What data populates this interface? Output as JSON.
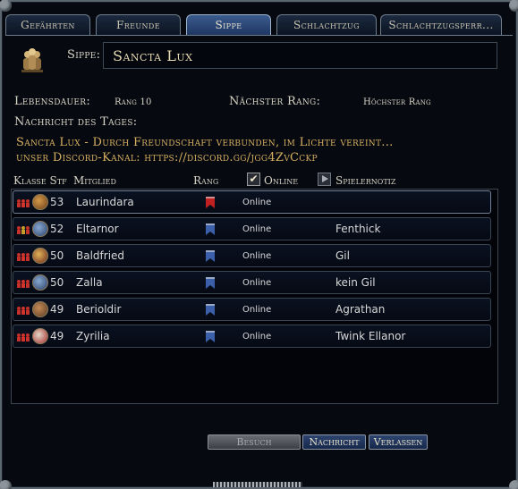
{
  "tabs": [
    "Gefährten",
    "Freunde",
    "Sippe",
    "Schlachtzug",
    "Schlachtzugsperr..."
  ],
  "active_tab": "Sippe",
  "kinship": {
    "name_label": "Sippe:",
    "name": "Sancta Lux",
    "lifetime_label": "Lebensdauer:",
    "lifetime_value": "Rang 10",
    "next_rank_label": "Nächster Rang:",
    "next_rank_value": "Höchster Rang",
    "motd_label": "Nachricht des Tages:",
    "motd_line1": "Sancta Lux - Durch Freundschaft verbunden, im Lichte vereint...",
    "motd_line2": "unser Discord-Kanal: https://discord.gg/jgg4ZvCckp"
  },
  "columns": {
    "class_level": "Klasse Stf",
    "member": "Mitglied",
    "rank": "Rang",
    "online": "Online",
    "check_mark": "✔",
    "player_note": "Spielernotiz"
  },
  "members": [
    {
      "level": "53",
      "name": "Laurindara",
      "status": "Online",
      "note": "",
      "class_icon": "burglar-class-icon",
      "rank_color": "#c02020",
      "lead_color": "#d2332b"
    },
    {
      "level": "52",
      "name": "Eltarnor",
      "status": "Online",
      "note": "Fenthick",
      "class_icon": "champion-class-icon",
      "rank_color": "#3b5fa8",
      "lead_color": "#c69f2a"
    },
    {
      "level": "50",
      "name": "Baldfried",
      "status": "Online",
      "note": "Gil",
      "class_icon": "lore-master-class-icon",
      "rank_color": "#3b5fa8",
      "lead_color": "#d2332b"
    },
    {
      "level": "50",
      "name": "Zalla",
      "status": "Online",
      "note": "kein Gil",
      "class_icon": "champion-class-icon",
      "rank_color": "#3b5fa8",
      "lead_color": "#d2332b"
    },
    {
      "level": "49",
      "name": "Berioldir",
      "status": "Online",
      "note": "Agrathan",
      "class_icon": "captain-class-icon",
      "rank_color": "#3b5fa8",
      "lead_color": "#d2332b"
    },
    {
      "level": "49",
      "name": "Zyrilia",
      "status": "Online",
      "note": "Twink Ellanor",
      "class_icon": "guardian-class-icon",
      "rank_color": "#3b5fa8",
      "lead_color": "#d2332b"
    }
  ],
  "buttons": {
    "visit": "Besuch",
    "message": "Nachricht",
    "leave": "Verlassen"
  }
}
